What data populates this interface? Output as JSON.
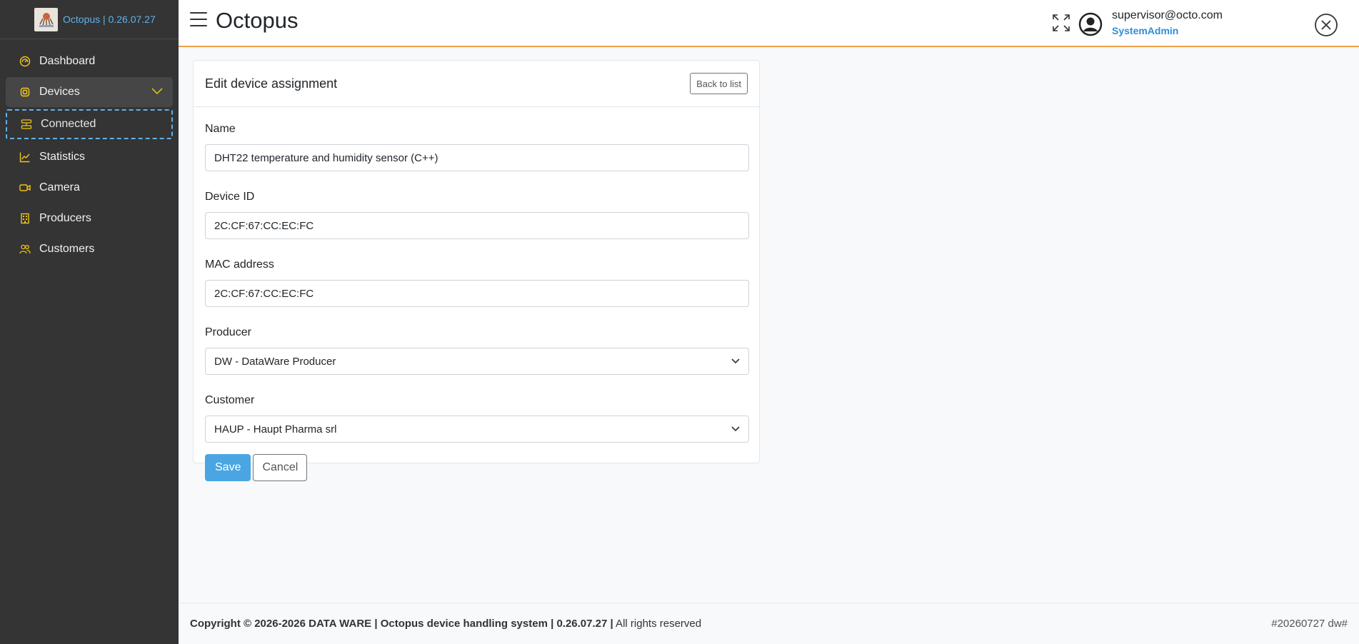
{
  "sidebar": {
    "brand": "Octopus | 0.26.07.27",
    "items": [
      {
        "label": "Dashboard",
        "icon": "dashboard-icon"
      },
      {
        "label": "Devices",
        "icon": "chip-icon"
      },
      {
        "label": "Connected",
        "icon": "connected-icon"
      },
      {
        "label": "Statistics",
        "icon": "chart-line-icon"
      },
      {
        "label": "Camera",
        "icon": "camera-icon"
      },
      {
        "label": "Producers",
        "icon": "building-icon"
      },
      {
        "label": "Customers",
        "icon": "users-icon"
      }
    ],
    "icon_color": "#f0c419"
  },
  "header": {
    "title": "Octopus",
    "user_email": "supervisor@octo.com",
    "user_role": "SystemAdmin",
    "accent": "#f0a24a"
  },
  "card": {
    "title": "Edit device assignment",
    "back_label": "Back to list",
    "fields": {
      "name": {
        "label": "Name",
        "value": "DHT22 temperature and humidity sensor (C++)"
      },
      "device_id": {
        "label": "Device ID",
        "value": "2C:CF:67:CC:EC:FC"
      },
      "mac": {
        "label": "MAC address",
        "value": "2C:CF:67:CC:EC:FC"
      },
      "producer": {
        "label": "Producer",
        "value": "DW - DataWare Producer"
      },
      "customer": {
        "label": "Customer",
        "value": "HAUP - Haupt Pharma srl"
      }
    },
    "save_label": "Save",
    "cancel_label": "Cancel"
  },
  "footer": {
    "copyright": "Copyright © 2026-2026 DATA WARE | Octopus device handling system | 0.26.07.27 |",
    "rights": " All rights reserved",
    "build": "#20260727 dw#"
  }
}
